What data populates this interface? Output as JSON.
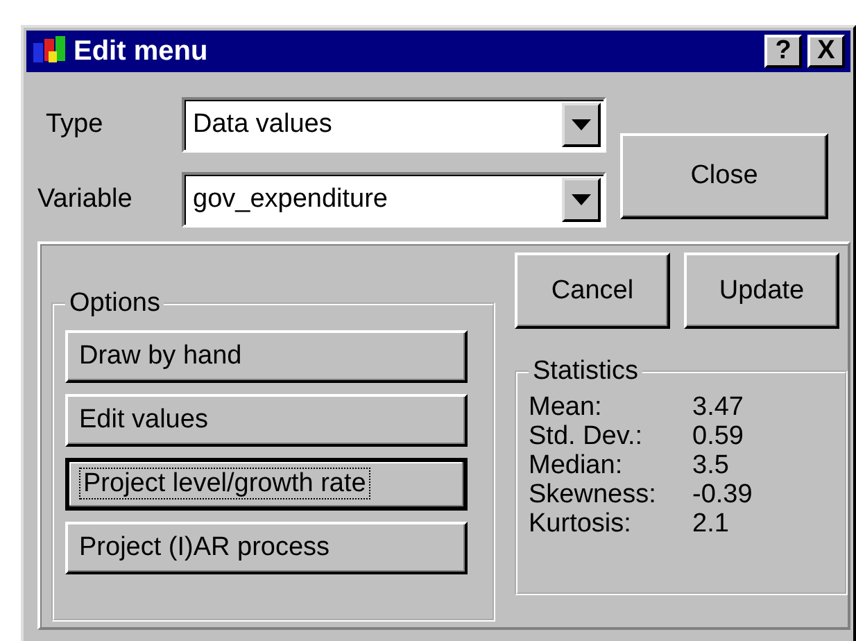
{
  "window": {
    "title": "Edit menu",
    "title_buttons": [
      "?",
      "X"
    ]
  },
  "fields": [
    {
      "label": "Type",
      "value": "Data values"
    },
    {
      "label": "Variable",
      "value": "gov_expenditure"
    }
  ],
  "close_button": "Close",
  "action_buttons": [
    "Cancel",
    "Update"
  ],
  "options": {
    "title": "Options",
    "buttons": [
      {
        "label": "Draw by hand",
        "focused": false
      },
      {
        "label": "Edit values",
        "focused": false
      },
      {
        "label": "Project level/growth rate",
        "focused": true
      },
      {
        "label": "Project (I)AR process",
        "focused": false
      }
    ]
  },
  "statistics": {
    "title": "Statistics",
    "rows": [
      {
        "name": "Mean:",
        "value": "3.47"
      },
      {
        "name": "Std. Dev.:",
        "value": "0.59"
      },
      {
        "name": "Median:",
        "value": "3.5"
      },
      {
        "name": "Skewness:",
        "value": "-0.39"
      },
      {
        "name": "Kurtosis:",
        "value": "2.1"
      }
    ]
  }
}
